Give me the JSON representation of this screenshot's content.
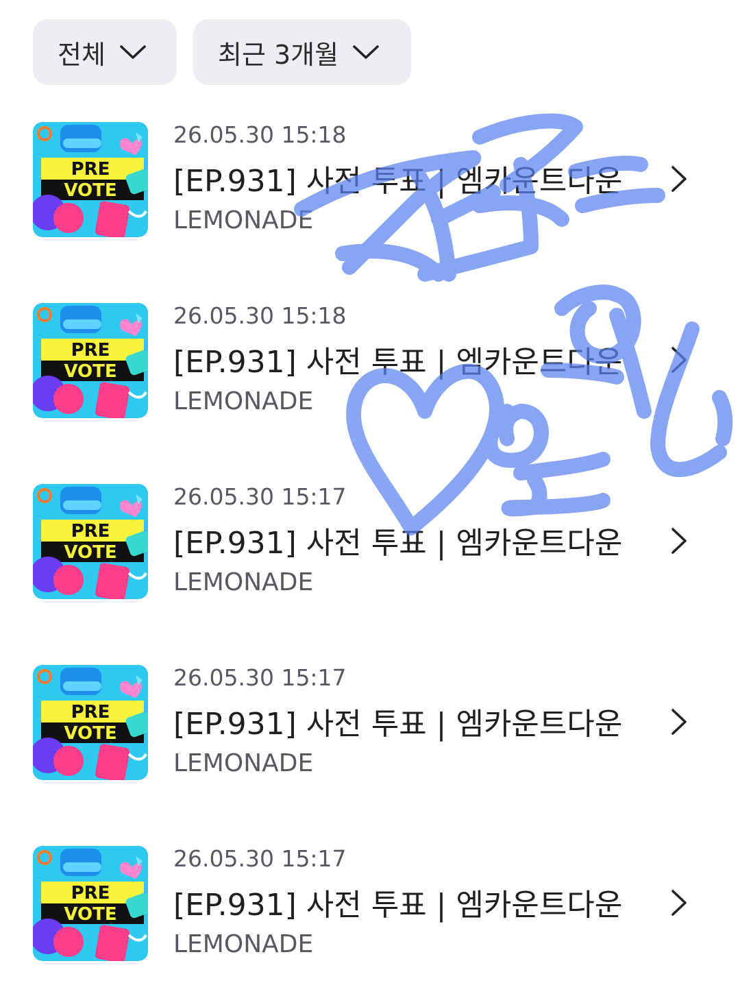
{
  "filters": {
    "category": {
      "label": "전체",
      "icon": "chevron-down-icon"
    },
    "period": {
      "label": "최근 3개월",
      "icon": "chevron-down-icon"
    }
  },
  "thumbnail": {
    "line1": "PRE",
    "line2": "VOTE",
    "colors": {
      "background": "#2ec8f0",
      "banner": "#f7f23a",
      "band": "#111111",
      "pink": "#ff3d8a",
      "purple": "#6b3df0"
    }
  },
  "items": [
    {
      "date": "26.05.30 15:18",
      "title": "[EP.931] 사전 투표 | 엠카운트다운",
      "subtitle": "LEMONADE"
    },
    {
      "date": "26.05.30 15:18",
      "title": "[EP.931] 사전 투표 | 엠카운트다운",
      "subtitle": "LEMONADE"
    },
    {
      "date": "26.05.30 15:17",
      "title": "[EP.931] 사전 투표 | 엠카운트다운",
      "subtitle": "LEMONADE"
    },
    {
      "date": "26.05.30 15:17",
      "title": "[EP.931] 사전 투표 | 엠카운트다운",
      "subtitle": "LEMONADE"
    },
    {
      "date": "26.05.30 15:17",
      "title": "[EP.931] 사전 투표 | 엠카운트다운",
      "subtitle": "LEMONADE"
    }
  ],
  "overlay": {
    "handwriting_color": "#5b83f0",
    "icons": [
      "heart-doodle-icon"
    ]
  }
}
